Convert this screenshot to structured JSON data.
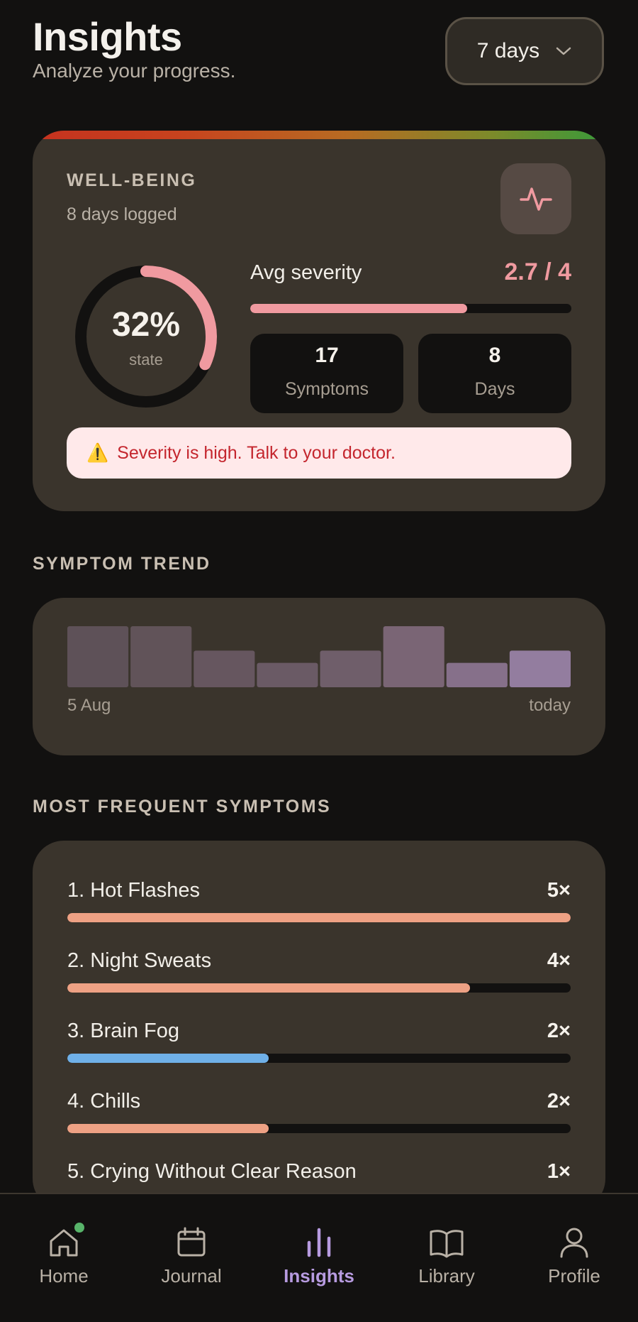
{
  "header": {
    "title": "Insights",
    "subtitle": "Analyze your progress."
  },
  "range_selector": {
    "value": "7 days",
    "icon": "chevron-down-icon"
  },
  "wellbeing": {
    "kicker": "WELL-BEING",
    "days_logged": "8 days logged",
    "icon": "pulse-icon",
    "ring_value": "32%",
    "ring_fraction": 0.32,
    "ring_label": "state",
    "avg_label": "Avg severity",
    "avg_value": "2.7 / 4",
    "avg_fraction": 0.675,
    "stats": [
      {
        "value": "17",
        "label": "Symptoms"
      },
      {
        "value": "8",
        "label": "Days"
      }
    ],
    "alert_icon": "⚠️",
    "alert_text": "Severity is high. Talk to your doctor.",
    "colors": {
      "accent_pink": "#f09aa0",
      "alert_bg": "#ffe9ea",
      "alert_text": "#c4262e"
    }
  },
  "trend": {
    "kicker": "SYMPTOM TREND",
    "start_label": "5 Aug",
    "end_label": "today",
    "values": [
      5,
      5,
      3,
      2,
      3,
      5,
      2,
      3
    ],
    "colors": [
      "#5e5158",
      "#615359",
      "#66565f",
      "#6a5a65",
      "#6f5e6a",
      "#7a6575",
      "#86708a",
      "#937d9f"
    ]
  },
  "symptoms": {
    "kicker": "MOST FREQUENT SYMPTOMS",
    "items": [
      {
        "name": "1. Hot Flashes",
        "count": "5×",
        "fraction": 1.0,
        "color": "#eea184"
      },
      {
        "name": "2. Night Sweats",
        "count": "4×",
        "fraction": 0.8,
        "color": "#eea184"
      },
      {
        "name": "3. Brain Fog",
        "count": "2×",
        "fraction": 0.4,
        "color": "#6fb0e8"
      },
      {
        "name": "4. Chills",
        "count": "2×",
        "fraction": 0.4,
        "color": "#eea184"
      },
      {
        "name": "5. Crying Without Clear Reason",
        "count": "1×",
        "fraction": 0.2,
        "color": "#eea184"
      }
    ]
  },
  "tabbar": {
    "tabs": [
      {
        "label": "Home",
        "icon": "home-icon"
      },
      {
        "label": "Journal",
        "icon": "calendar-icon"
      },
      {
        "label": "Insights",
        "icon": "bar-chart-icon",
        "active": true
      },
      {
        "label": "Library",
        "icon": "book-icon"
      },
      {
        "label": "Profile",
        "icon": "user-icon"
      }
    ]
  }
}
